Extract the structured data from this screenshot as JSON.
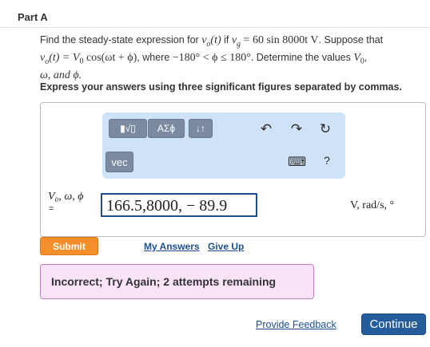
{
  "part": {
    "title": "Part A"
  },
  "problem": {
    "t1": "Find the steady-state expression for ",
    "vo_t": "v",
    "vo_sub": "o",
    "vo_arg": "(t)",
    "t2": " if ",
    "vg": "v",
    "vg_sub": "g",
    "vg_eq": " = 60 sin 8000t V",
    "t3": ". Suppose that",
    "l2_lhs": "v",
    "l2_sub": "o",
    "l2_expr": "(t) = V",
    "l2_sub0": "0",
    "l2_rest": " cos(ωt + ϕ)",
    "t4": ", where ",
    "cond": "−180° < ϕ ≤ 180°",
    "t5": ". Determine the values ",
    "V0": "V",
    "V0_sub": "0",
    "t6": ",",
    "l3": "ω, and ϕ."
  },
  "instructions": "Express your answers using three significant figures separated by commas.",
  "toolbar": {
    "templates_label": "▮√▯",
    "greek_label": "ΑΣϕ",
    "sort_label": "↓↑",
    "vec_label": "vec",
    "undo_icon": "↶",
    "redo_icon": "↷",
    "reset_icon": "↻",
    "keyboard_icon": "⌨",
    "help_label": "?"
  },
  "answer": {
    "variables": "V₀, ω, ϕ",
    "equals": "=",
    "value": "166.5,8000, − 89.9",
    "units": "V, rad/s, °"
  },
  "actions": {
    "submit": "Submit",
    "my_answers": "My Answers",
    "give_up": "Give Up"
  },
  "feedback": {
    "message": "Incorrect; Try Again; 2 attempts remaining"
  },
  "footer": {
    "provide_feedback": "Provide Feedback",
    "continue": "Continue"
  },
  "colors": {
    "submit": "#f58f29",
    "toolbar_bg": "#cfe3f8",
    "feedback_bg": "#f9e4f7",
    "continue": "#255d9c"
  }
}
